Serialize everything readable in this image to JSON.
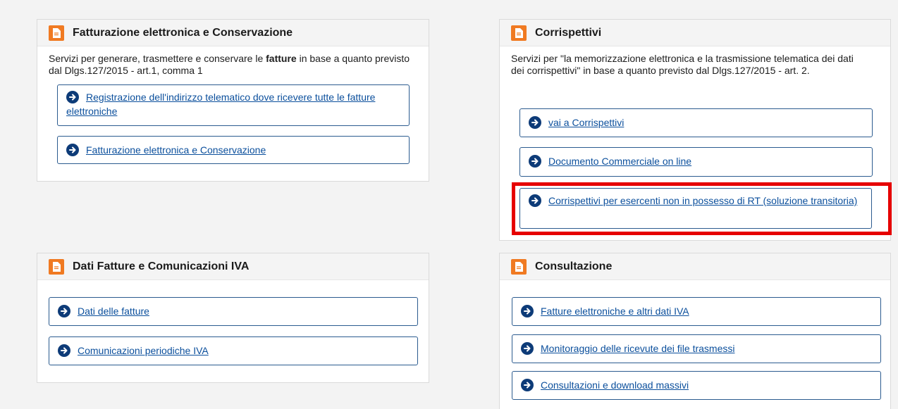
{
  "cards": {
    "fatturazione": {
      "title": "Fatturazione elettronica e Conservazione",
      "desc_before": "Servizi per generare, trasmettere e conservare le ",
      "desc_bold": "fatture",
      "desc_after": " in base a quanto previsto dal Dlgs.127/2015 - art.1, comma 1",
      "links": [
        "Registrazione dell'indirizzo telematico dove ricevere tutte le fatture elettroniche",
        "Fatturazione elettronica e Conservazione"
      ]
    },
    "corrispettivi": {
      "title": "Corrispettivi",
      "desc": "Servizi per \"la memorizzazione elettronica e la trasmissione telematica dei dati dei corrispettivi\" in base a quanto previsto dal Dlgs.127/2015 - art. 2.",
      "links": [
        "vai a Corrispettivi",
        "Documento Commerciale on line",
        "Corrispettivi per esercenti non in possesso di RT (soluzione transitoria)"
      ]
    },
    "dati_fatture": {
      "title": "Dati Fatture e Comunicazioni IVA",
      "links": [
        "Dati delle fatture",
        "Comunicazioni periodiche IVA"
      ]
    },
    "consultazione": {
      "title": "Consultazione",
      "links": [
        "Fatture elettroniche e altri dati IVA",
        "Monitoraggio delle ricevute dei file trasmessi",
        "Consultazioni e download massivi"
      ]
    }
  },
  "icons": {
    "card_icon": "document-icon",
    "link_icon": "arrow-right-circle-icon"
  },
  "colors": {
    "accent_orange": "#f07a22",
    "link_blue": "#0b4f9c",
    "arrow_navy": "#0d3b78",
    "highlight_red": "#e60000"
  }
}
